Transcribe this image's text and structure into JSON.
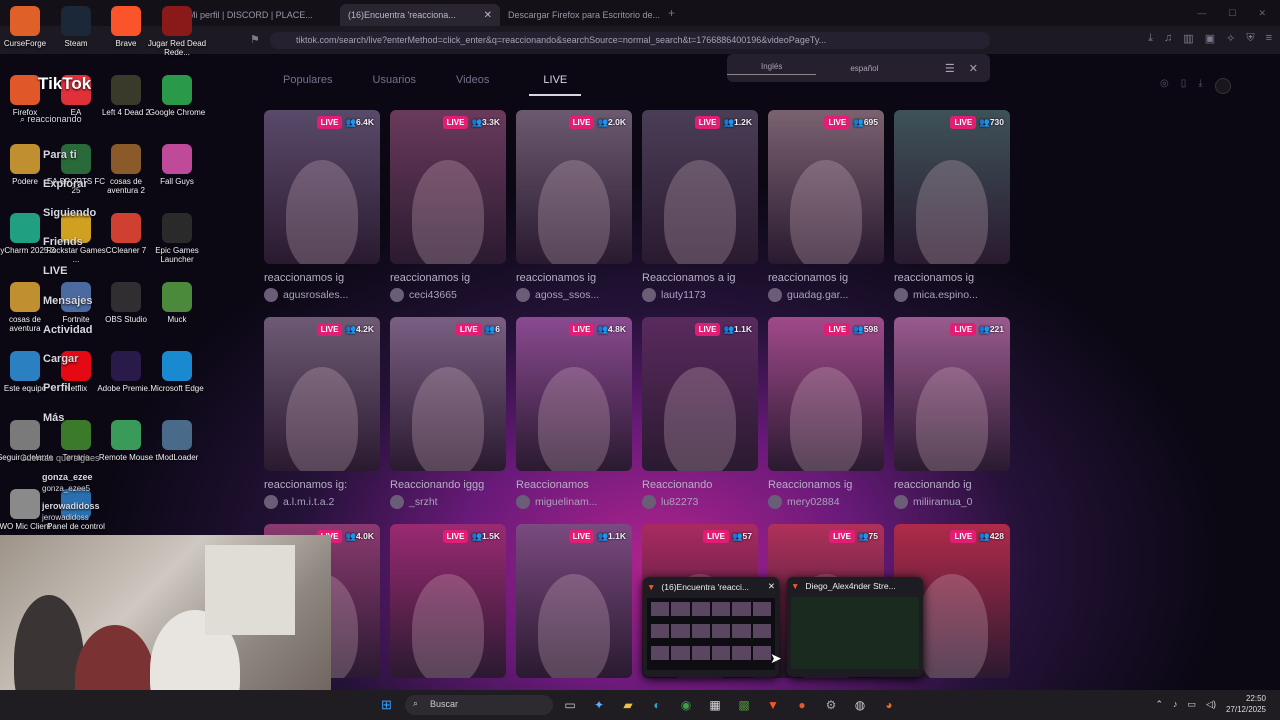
{
  "browser": {
    "tabs": [
      {
        "title": "Mi perfil | DISCORD | PLACE..."
      },
      {
        "title": "(16)Encuentra 'reacciona...",
        "active": true
      },
      {
        "title": "Descargar Firefox para Escritorio de..."
      }
    ],
    "url": "tiktok.com/search/live?enterMethod=click_enter&q=reaccionando&searchSource=normal_search&t=1766886400196&videoPageTy..."
  },
  "tiktok": {
    "logo": "TikTok",
    "search_value": "reaccionando",
    "nav": [
      "Para ti",
      "Explorar",
      "Siguiendo",
      "Friends",
      "LIVE",
      "Mensajes",
      "Actividad",
      "Cargar",
      "Perfil",
      "Más"
    ],
    "following_header": "Cuentas que sigues",
    "following": [
      {
        "name": "gonza_ezee",
        "handle": "gonza_ezee5"
      },
      {
        "name": "jerowadidoss",
        "handle": "jerowadidoss"
      }
    ],
    "subtabs": [
      "Populares",
      "Usuarios",
      "Videos",
      "LIVE"
    ],
    "selected_subtab": "LIVE",
    "lang_options": [
      "Inglés",
      "español"
    ],
    "lives": [
      {
        "badge": "LIVE",
        "viewers": "6.4K",
        "title": "reaccionamos ig",
        "user": "agusrosales...",
        "color": "#5a4a6a"
      },
      {
        "badge": "LIVE",
        "viewers": "3.3K",
        "title": "reaccionamos ig",
        "user": "ceci43665",
        "color": "#6a3a5c"
      },
      {
        "badge": "LIVE",
        "viewers": "2.0K",
        "title": "reaccionamos ig",
        "user": "agoss_ssos...",
        "color": "#6b5a70"
      },
      {
        "badge": "LIVE",
        "viewers": "1.2K",
        "title": "Reaccionamos a ig",
        "user": "lauty1173",
        "color": "#4a3e56"
      },
      {
        "badge": "LIVE",
        "viewers": "695",
        "title": "reaccionamos ig",
        "user": "guadag.gar...",
        "color": "#7a6270"
      },
      {
        "badge": "LIVE",
        "viewers": "730",
        "title": "reaccionamos ig",
        "user": "mica.espino...",
        "color": "#3e5258"
      },
      {
        "badge": "LIVE",
        "viewers": "4.2K",
        "title": "reaccionamos ig:",
        "user": "a.l.m.i.t.a.2",
        "color": "#6e5a74"
      },
      {
        "badge": "LIVE",
        "viewers": "6",
        "title": "Reaccionando iggg",
        "user": "_srzht",
        "color": "#7a5f82"
      },
      {
        "badge": "LIVE",
        "viewers": "4.8K",
        "title": "Reaccionamos",
        "user": "miguelinam...",
        "color": "#8a4a90"
      },
      {
        "badge": "LIVE",
        "viewers": "1.1K",
        "title": "Reaccionando",
        "user": "lu82273",
        "color": "#5a2a5e"
      },
      {
        "badge": "LIVE",
        "viewers": "598",
        "title": "Reaccionamos ig",
        "user": "mery02884",
        "color": "#a04a8a"
      },
      {
        "badge": "LIVE",
        "viewers": "221",
        "title": "reaccionando ig",
        "user": "miliiramua_0",
        "color": "#9a5a8e"
      },
      {
        "badge": "LIVE",
        "viewers": "4.0K",
        "title": "",
        "user": "",
        "color": "#8a3a70"
      },
      {
        "badge": "LIVE",
        "viewers": "1.5K",
        "title": "",
        "user": "",
        "color": "#9a2a72"
      },
      {
        "badge": "LIVE",
        "viewers": "1.1K",
        "title": "",
        "user": "",
        "color": "#7a4a80"
      },
      {
        "badge": "LIVE",
        "viewers": "57",
        "title": "",
        "user": "",
        "color": "#aa2a60"
      },
      {
        "badge": "LIVE",
        "viewers": "75",
        "title": "",
        "user": "",
        "color": "#b0305a"
      },
      {
        "badge": "LIVE",
        "viewers": "428",
        "title": "",
        "user": "",
        "color": "#b02a4a"
      }
    ]
  },
  "desktop_icons": [
    {
      "label": "CurseForge",
      "color": "#e0602a"
    },
    {
      "label": "Steam",
      "color": "#1b2838"
    },
    {
      "label": "Brave",
      "color": "#fb542b"
    },
    {
      "label": "Jugar Red Dead Rede...",
      "color": "#8a1a1a"
    },
    {
      "label": "Firefox",
      "color": "#e0582a"
    },
    {
      "label": "EA",
      "color": "#e0303a"
    },
    {
      "label": "Left 4 Dead 2",
      "color": "#3a3a2a"
    },
    {
      "label": "Google Chrome",
      "color": "#2a9a4a"
    },
    {
      "label": "Podere",
      "color": "#c09030"
    },
    {
      "label": "EA SPORTS FC 25",
      "color": "#2a6a3a"
    },
    {
      "label": "cosas de aventura 2",
      "color": "#8a5a2a"
    },
    {
      "label": "Fall Guys",
      "color": "#c04a9a"
    },
    {
      "label": "PyCharm 2025.3",
      "color": "#20a080"
    },
    {
      "label": "Rockstar Games ...",
      "color": "#d0a020"
    },
    {
      "label": "CCleaner 7",
      "color": "#d04030"
    },
    {
      "label": "Epic Games Launcher",
      "color": "#2a2a2a"
    },
    {
      "label": "cosas de aventura",
      "color": "#c09030"
    },
    {
      "label": "Fortnite",
      "color": "#4a6aa0"
    },
    {
      "label": "OBS Studio",
      "color": "#302e31"
    },
    {
      "label": "Muck",
      "color": "#4a8a3a"
    },
    {
      "label": "Este equipo",
      "color": "#2a80c0"
    },
    {
      "label": "Netflix",
      "color": "#e50914"
    },
    {
      "label": "Adobe Premie...",
      "color": "#2a1a4a"
    },
    {
      "label": "Microsoft Edge",
      "color": "#1a8ad0"
    },
    {
      "label": "Seguir adelante",
      "color": "#7a7a7a"
    },
    {
      "label": "Terraria",
      "color": "#3a7a2a"
    },
    {
      "label": "Remote Mouse",
      "color": "#3a9a5a"
    },
    {
      "label": "tModLoader",
      "color": "#4a6a8a"
    },
    {
      "label": "WO Mic Client",
      "color": "#8a8a8a"
    },
    {
      "label": "Panel de control",
      "color": "#2a70b0"
    }
  ],
  "taskbar": {
    "search_label": "Buscar",
    "apps": [
      "file-icon",
      "copilot-icon",
      "folder-icon",
      "edge-icon",
      "chrome-icon",
      "store-icon",
      "minecraft-icon",
      "brave-icon",
      "mic-icon",
      "settings-icon",
      "obs-icon",
      "firefox-icon"
    ],
    "time": "22:50",
    "date": "27/12/2025"
  },
  "previews": [
    {
      "title": "(16)Encuentra 'reacci..."
    },
    {
      "title": "Diego_Alex4nder Stre..."
    }
  ]
}
